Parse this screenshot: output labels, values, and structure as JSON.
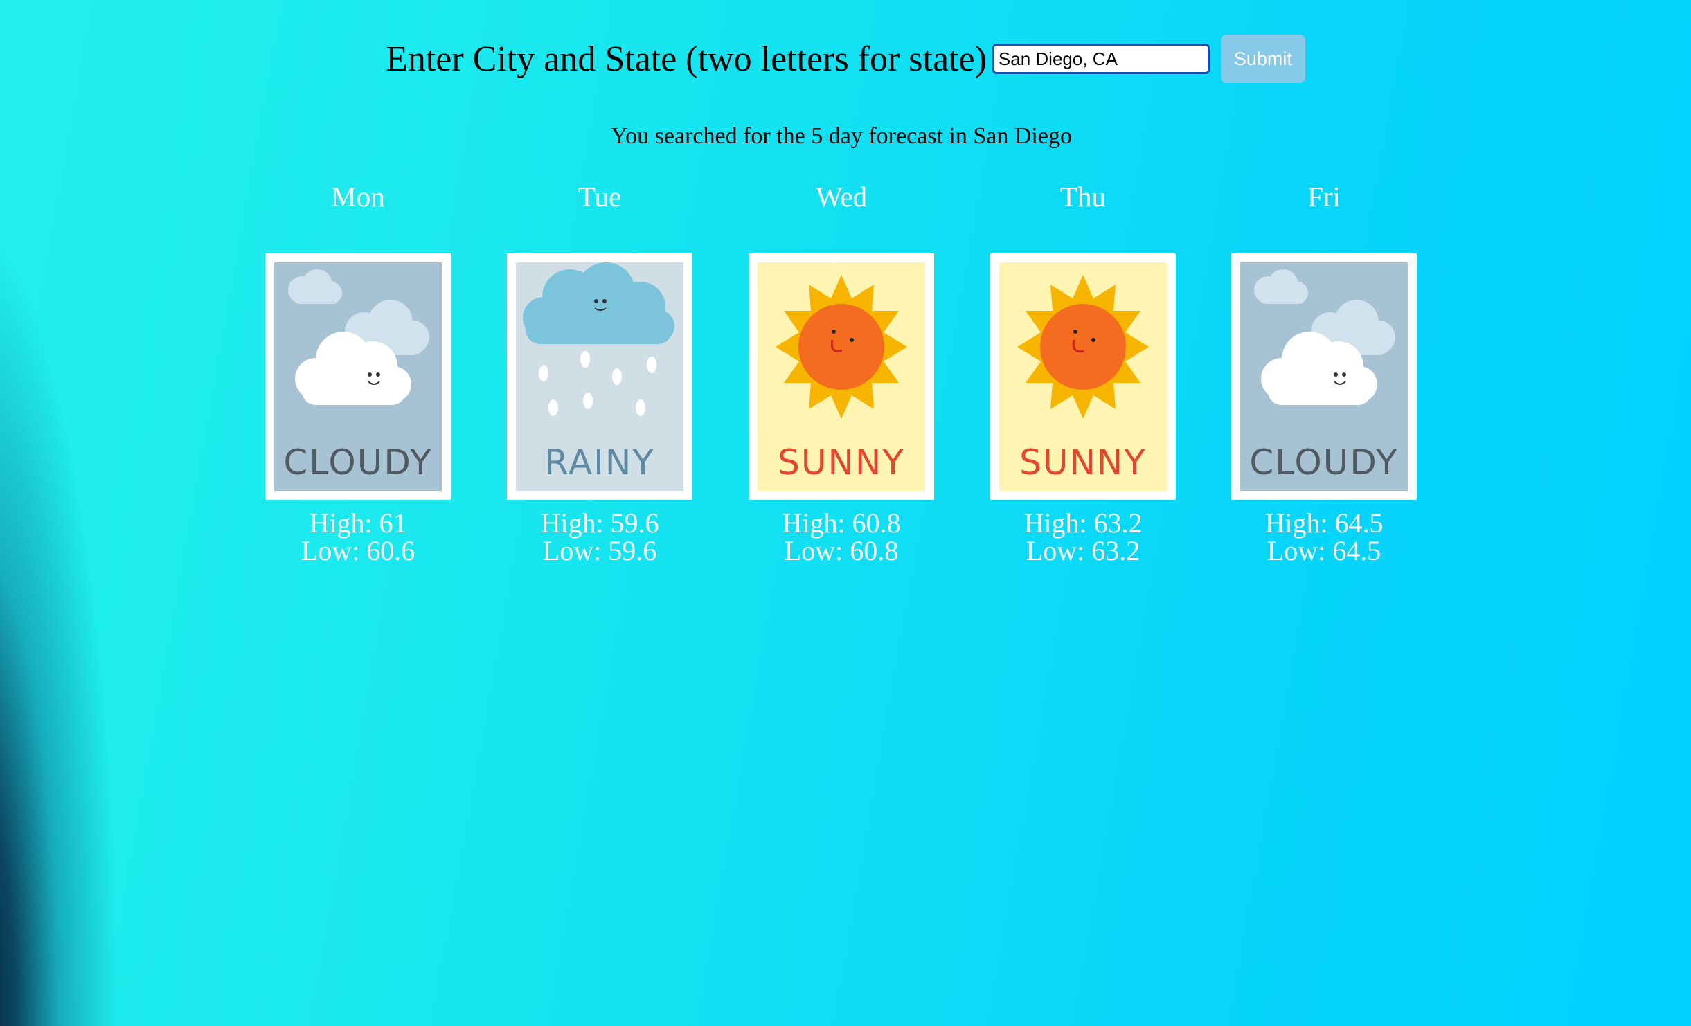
{
  "search": {
    "prompt": "Enter City and State (two letters for state)",
    "value": "San Diego, CA",
    "submit_label": "Submit"
  },
  "result_text": "You searched for the 5 day forecast in San Diego",
  "forecast": [
    {
      "day": "Mon",
      "condition": "cloudy",
      "card_label": "CLOUDY",
      "high": "High: 61",
      "low": "Low: 60.6"
    },
    {
      "day": "Tue",
      "condition": "rainy",
      "card_label": "RAINY",
      "high": "High: 59.6",
      "low": "Low: 59.6"
    },
    {
      "day": "Wed",
      "condition": "sunny",
      "card_label": "SUNNY",
      "high": "High: 60.8",
      "low": "Low: 60.8"
    },
    {
      "day": "Thu",
      "condition": "sunny",
      "card_label": "SUNNY",
      "high": "High: 63.2",
      "low": "Low: 63.2"
    },
    {
      "day": "Fri",
      "condition": "cloudy",
      "card_label": "CLOUDY",
      "high": "High: 64.5",
      "low": "Low: 64.5"
    }
  ],
  "colors": {
    "background": "#17e6ef",
    "submit_button": "#86c9e8",
    "input_border": "#1a4fb4",
    "day_text": "#ffffff"
  }
}
